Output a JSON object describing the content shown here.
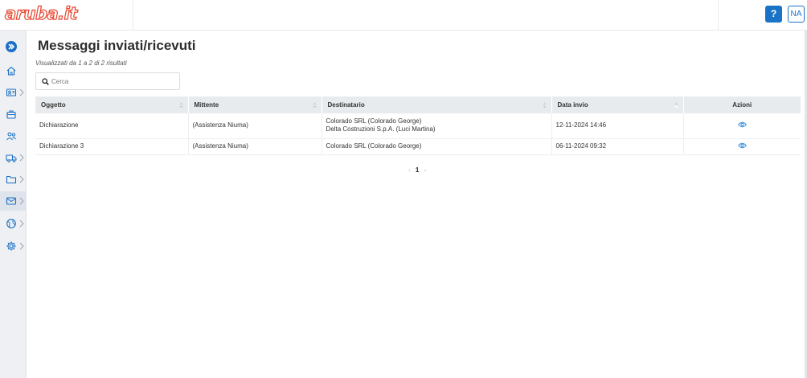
{
  "app": {
    "logo_text": "aruba.it",
    "brand_color": "#e8442c",
    "accent_color": "#1a73c7"
  },
  "header": {
    "help_label": "?",
    "user_initials": "NA"
  },
  "sidebar": {
    "items": [
      {
        "icon": "expand-icon",
        "has_chevron": false
      },
      {
        "icon": "home-icon",
        "has_chevron": false
      },
      {
        "icon": "contact-card-icon",
        "has_chevron": true
      },
      {
        "icon": "briefcase-icon",
        "has_chevron": false
      },
      {
        "icon": "users-icon",
        "has_chevron": false
      },
      {
        "icon": "truck-icon",
        "has_chevron": true
      },
      {
        "icon": "folder-icon",
        "has_chevron": true
      },
      {
        "icon": "mail-icon",
        "has_chevron": true,
        "active": true
      },
      {
        "icon": "globe-icon",
        "has_chevron": true
      },
      {
        "icon": "gear-icon",
        "has_chevron": true
      }
    ]
  },
  "main": {
    "title": "Messaggi inviati/ricevuti",
    "results_text": "Visualizzati da 1 a 2 di 2 risultati",
    "search": {
      "placeholder": "Cerca",
      "value": ""
    },
    "table": {
      "columns": [
        "Oggetto",
        "Mittente",
        "Destinatario",
        "Data invio",
        "Azioni"
      ],
      "rows": [
        {
          "oggetto": "Dichiarazione",
          "mittente": "(Assistenza Niuma)",
          "destinatario_1": "Colorado SRL (Colorado George)",
          "destinatario_2": "Delta Costruzioni S.p.A. (Luci Martina)",
          "data_invio": "12-11-2024 14:46",
          "azione_icon": "view-eye-icon"
        },
        {
          "oggetto": "Dichiarazione 3",
          "mittente": "(Assistenza Niuma)",
          "destinatario_1": "Colorado SRL (Colorado George)",
          "destinatario_2": "",
          "data_invio": "06-11-2024 09:32",
          "azione_icon": "view-eye-icon"
        }
      ]
    },
    "pagination": {
      "prev": "‹",
      "current_page": "1",
      "next": "›"
    }
  }
}
